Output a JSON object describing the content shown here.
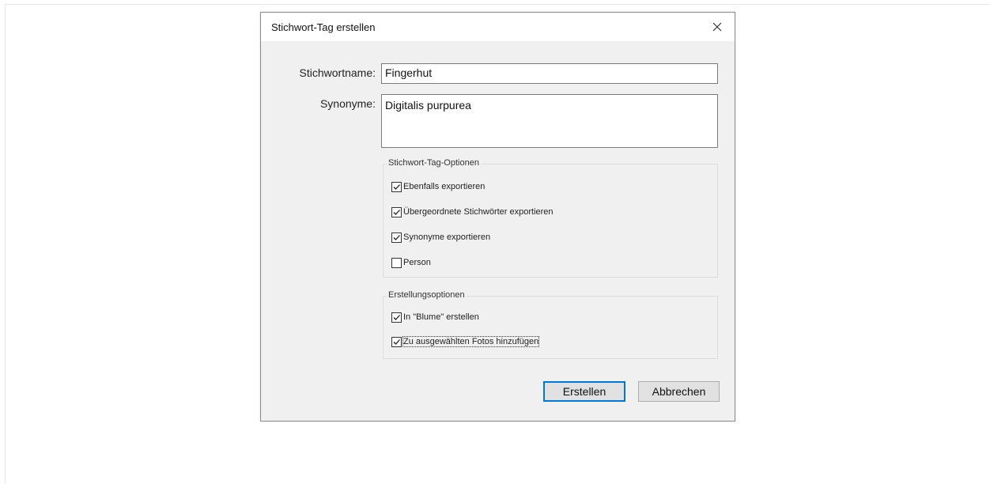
{
  "dialog": {
    "title": "Stichwort-Tag erstellen",
    "close_icon": "close-icon"
  },
  "form": {
    "name_label": "Stichwortname:",
    "name_value": "Fingerhut",
    "synonyms_label": "Synonyme:",
    "synonyms_value": "Digitalis purpurea"
  },
  "tag_options": {
    "legend": "Stichwort-Tag-Optionen",
    "items": [
      {
        "label": "Ebenfalls exportieren",
        "checked": true
      },
      {
        "label": "Übergeordnete Stichwörter exportieren",
        "checked": true
      },
      {
        "label": "Synonyme exportieren",
        "checked": true
      },
      {
        "label": "Person",
        "checked": false
      }
    ]
  },
  "create_options": {
    "legend": "Erstellungsoptionen",
    "items": [
      {
        "label": "In \"Blume\" erstellen",
        "checked": true
      },
      {
        "label": "Zu ausgewählten Fotos hinzufügen",
        "checked": true
      }
    ]
  },
  "buttons": {
    "create_label": "Erstellen",
    "cancel_label": "Abbrechen"
  },
  "colors": {
    "dialog_background": "#f0f0f0",
    "default_button_border": "#0078d7"
  }
}
